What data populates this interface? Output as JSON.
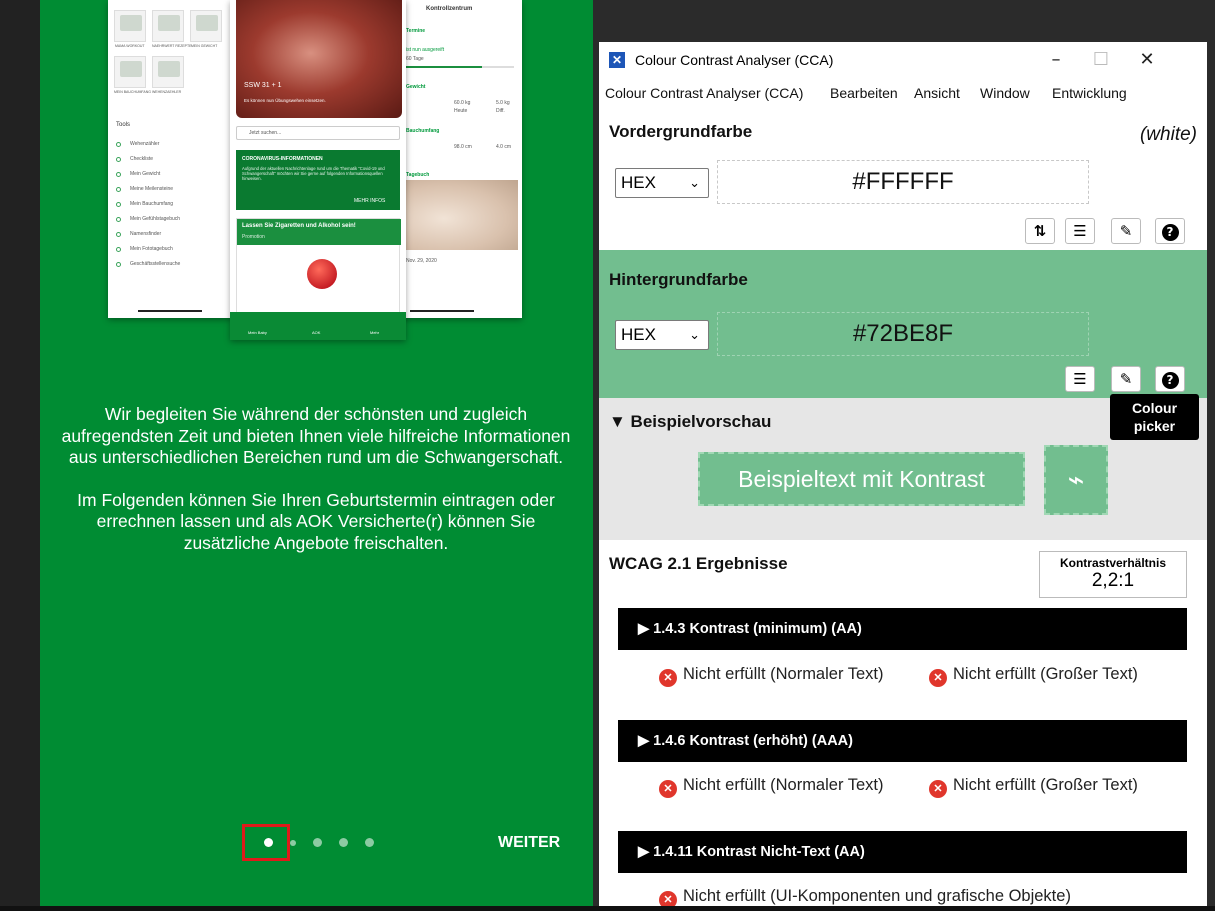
{
  "app": {
    "intro_p1": "Wir begleiten Sie während der schönsten und zugleich aufregendsten Zeit und bieten Ihnen viele hilfreiche Informationen aus unterschiedlichen Bereichen rund um die Schwangerschaft.",
    "intro_p2": "Im Folgenden können Sie Ihren Geburtstermin eintragen oder errechnen lassen und als AOK Versicherte(r) können Sie zusätzliche Angebote freischalten.",
    "next_label": "WEITER",
    "pager_dots": 5,
    "active_dot": 1,
    "mockup": {
      "ssw": "SSW 31 + 1",
      "ssw_sub": "Es können nun Übungswehen einsetzen.",
      "search_placeholder": "Jetzt suchen...",
      "corona_title": "CORONAVIRUS-INFORMATIONEN",
      "corona_text": "Aufgrund der aktuellen Nachrichtenlage rund um die Thematik \"Covid-19 und Schwangerschaft\" möchten wir Sie gerne auf folgenden Informationsquellen hinweisen.",
      "corona_more": "MEHR INFOS",
      "promo_title": "Lassen Sie Zigaretten und Alkohol sein!",
      "promo_label": "Promotion",
      "tools_heading": "Tools",
      "tools": [
        "Wehenzähler",
        "Checkliste",
        "Mein Gewicht",
        "Meine Meilensteine",
        "Mein Bauchumfang",
        "Mein Gefühlstagebuch",
        "Namensfinder",
        "Mein Fototagebuch",
        "Geschäftsstellensuche"
      ],
      "tiles": [
        "MAMA WORKOUT",
        "NAEHRWERT REZEPTE",
        "MEIN GEWICHT",
        "MEIN BAUCHUMFANG",
        "WEHENZAEHLER"
      ],
      "right_header": "Kontrollzentrum",
      "right_items": [
        "Termine",
        "Gewicht",
        "Bauchumfang",
        "Tagebuch"
      ],
      "right_values": [
        "60.0 kg",
        "5.0 kg",
        "98.0 cm",
        "4.0 cm"
      ],
      "right_sub": [
        "Heute",
        "Diff."
      ],
      "right_progress_label": "ist nun ausgereift",
      "right_days": "60 Tage",
      "right_date": "Nov. 29, 2020",
      "tab_labels": [
        "Mein Baby",
        "AOK",
        "Mehr"
      ]
    }
  },
  "cca": {
    "window_title": "Colour Contrast Analyser (CCA)",
    "menu": [
      "Colour Contrast Analyser (CCA)",
      "Bearbeiten",
      "Ansicht",
      "Window",
      "Entwicklung"
    ],
    "foreground": {
      "heading": "Vordergrundfarbe",
      "name": "(white)",
      "format": "HEX",
      "value": "#FFFFFF"
    },
    "background": {
      "heading": "Hintergrundfarbe",
      "format": "HEX",
      "value": "#72BE8F",
      "color": "#72BE8F"
    },
    "tooltip": "Colour picker",
    "preview": {
      "heading": "▼ Beispielvorschau",
      "sample_text": "Beispieltext mit Kontrast"
    },
    "results": {
      "heading": "WCAG 2.1 Ergebnisse",
      "ratio_label": "Kontrastverhältnis",
      "ratio_value": "2,2:1",
      "criteria": [
        {
          "label": "▶ 1.4.3 Kontrast (minimum) (AA)",
          "normal": "Nicht erfüllt (Normaler Text)",
          "large": "Nicht erfüllt (Großer Text)"
        },
        {
          "label": "▶ 1.4.6 Kontrast (erhöht) (AAA)",
          "normal": "Nicht erfüllt (Normaler Text)",
          "large": "Nicht erfüllt (Großer Text)"
        },
        {
          "label": "▶ 1.4.11 Kontrast Nicht-Text (AA)",
          "ui": "Nicht erfüllt (UI-Komponenten und grafische Objekte)"
        }
      ]
    }
  },
  "colors": {
    "app_green": "#008C33",
    "cca_bg_green": "#72BE8F",
    "fail_red": "#E0362C",
    "highlight_red": "#E01A1A"
  }
}
